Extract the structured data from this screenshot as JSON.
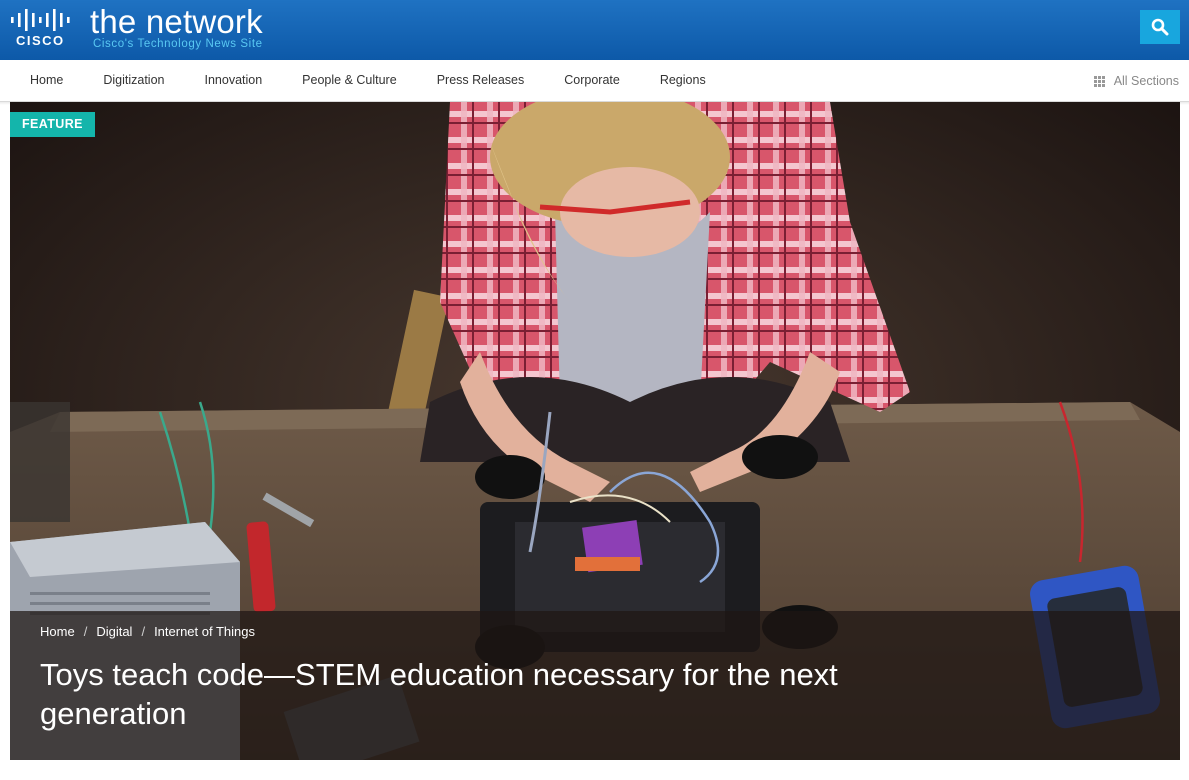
{
  "header": {
    "logo_text": "CISCO",
    "title": "the network",
    "subtitle": "Cisco's Technology News Site",
    "search_icon": "search-icon"
  },
  "nav": {
    "items": [
      {
        "label": "Home"
      },
      {
        "label": "Digitization"
      },
      {
        "label": "Innovation"
      },
      {
        "label": "People & Culture"
      },
      {
        "label": "Press Releases"
      },
      {
        "label": "Corporate"
      },
      {
        "label": "Regions"
      }
    ],
    "all_sections_label": "All Sections",
    "all_sections_icon": "grid-icon"
  },
  "hero": {
    "badge": "FEATURE",
    "breadcrumb": [
      {
        "label": "Home"
      },
      {
        "label": "Digital"
      },
      {
        "label": "Internet of Things"
      }
    ],
    "separator": "/",
    "headline": "Toys teach code—STEM education necessary for the next generation"
  },
  "colors": {
    "header_blue": "#1a69b8",
    "brand_subtitle": "#59c8f2",
    "search_button": "#18a6de",
    "badge_teal": "#14b5ab"
  }
}
